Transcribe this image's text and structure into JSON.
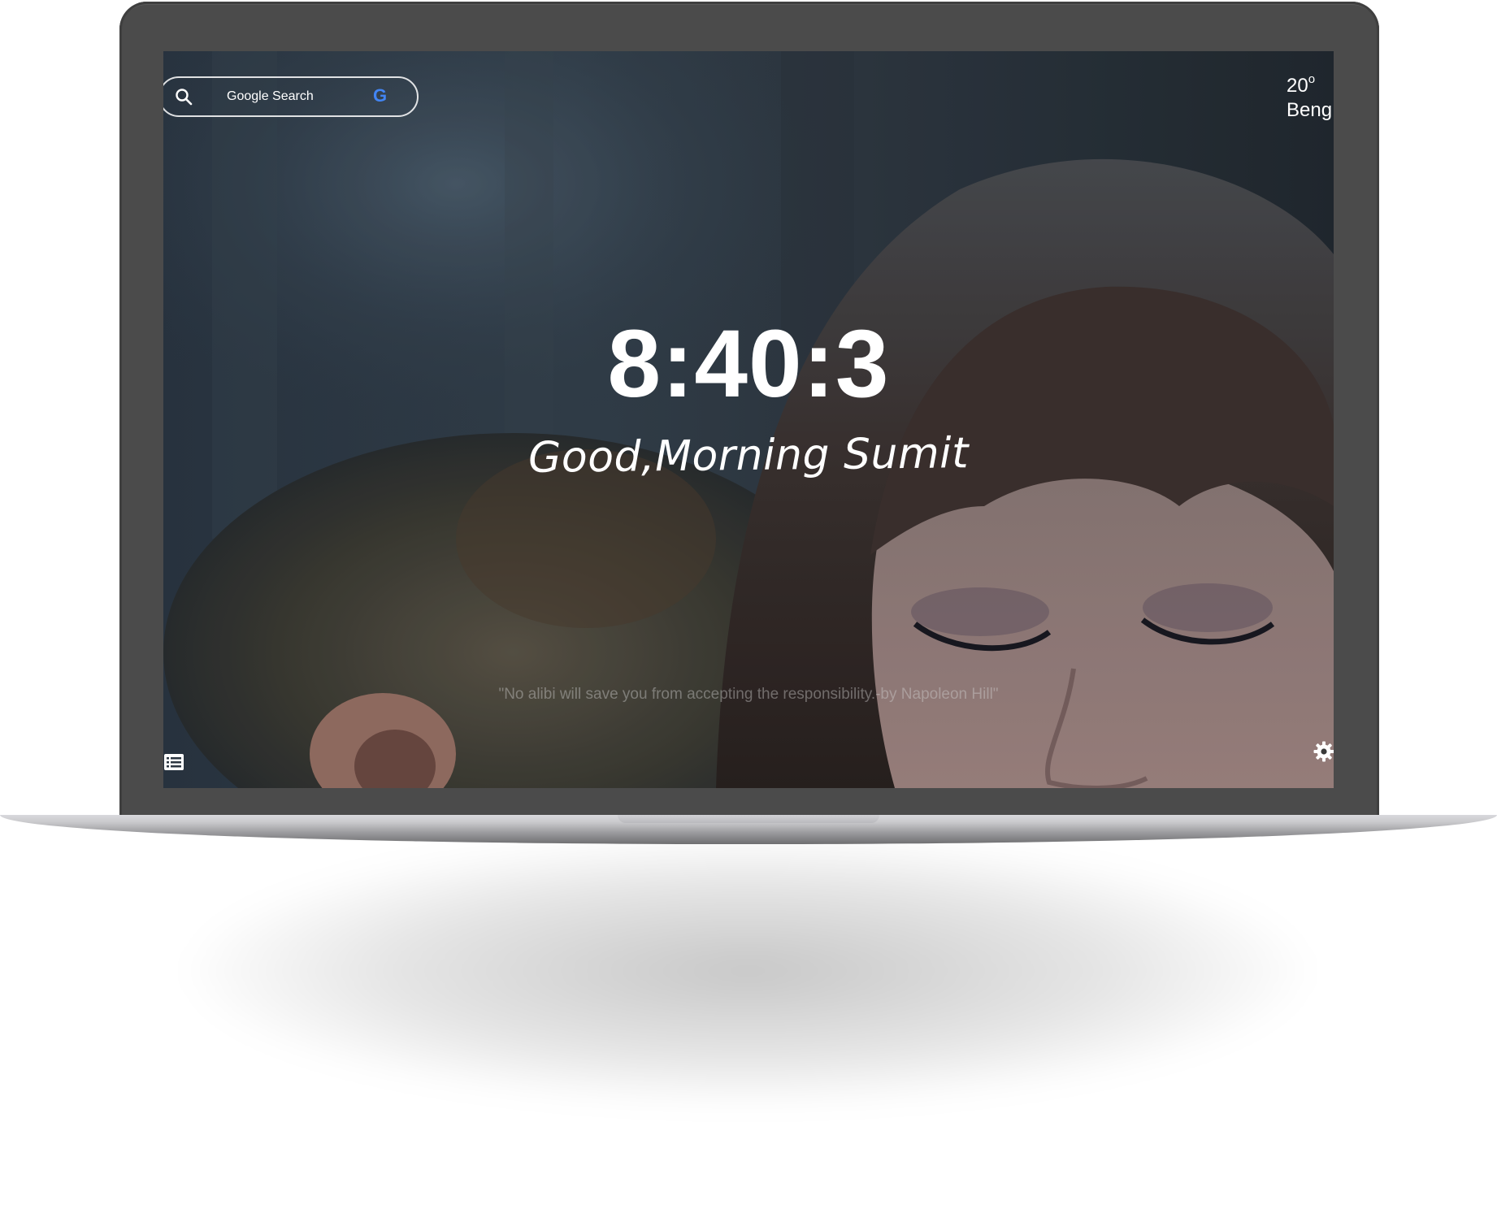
{
  "search": {
    "label": "Google Search",
    "engine_icon_letter": "G",
    "engine_icon_color": "#4285f4"
  },
  "weather": {
    "temperature": "20",
    "degree_symbol": "o",
    "city": "Beng"
  },
  "clock": {
    "time": "8:40:3"
  },
  "greeting": {
    "text": "Good,Morning Sumit"
  },
  "quote": {
    "text": "\"No alibi will save you from accepting the responsibility.-by Napoleon Hill\""
  },
  "icons": {
    "search": "search-icon",
    "google": "google-g-icon",
    "list": "list-icon",
    "settings": "gear-icon"
  },
  "colors": {
    "laptop_bezel": "#4b4b4b",
    "text": "#ffffff",
    "quote_text": "#d2d2d2"
  }
}
